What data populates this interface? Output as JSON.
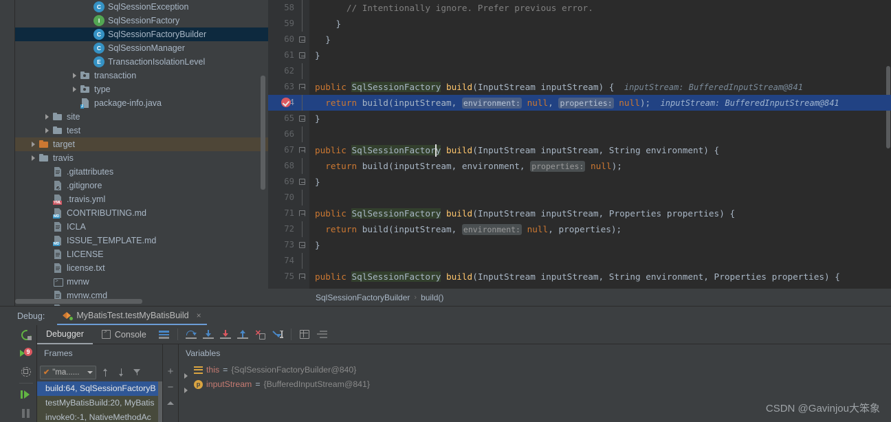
{
  "project_tree": {
    "items": [
      {
        "label": "SqlSessionException",
        "icon": "class-icon",
        "indent": 5,
        "type": "class",
        "twisty": false,
        "state": "normal"
      },
      {
        "label": "SqlSessionFactory",
        "icon": "interface-icon",
        "indent": 5,
        "type": "interface",
        "twisty": false,
        "state": "normal"
      },
      {
        "label": "SqlSessionFactoryBuilder",
        "icon": "class-icon",
        "indent": 5,
        "type": "class",
        "twisty": false,
        "state": "selected"
      },
      {
        "label": "SqlSessionManager",
        "icon": "class-icon",
        "indent": 5,
        "type": "class",
        "twisty": false,
        "state": "normal"
      },
      {
        "label": "TransactionIsolationLevel",
        "icon": "enum-icon",
        "indent": 5,
        "type": "enum",
        "twisty": false,
        "state": "normal"
      },
      {
        "label": "transaction",
        "icon": "package-folder-icon",
        "indent": 4,
        "type": "package",
        "twisty": true,
        "state": "normal"
      },
      {
        "label": "type",
        "icon": "package-folder-icon",
        "indent": 4,
        "type": "package",
        "twisty": true,
        "state": "normal"
      },
      {
        "label": "package-info.java",
        "icon": "java-file-icon",
        "indent": 4,
        "type": "javafile",
        "twisty": false,
        "state": "normal"
      },
      {
        "label": "site",
        "icon": "folder-icon",
        "indent": 2,
        "type": "folder",
        "twisty": true,
        "state": "normal"
      },
      {
        "label": "test",
        "icon": "folder-icon",
        "indent": 2,
        "type": "folder",
        "twisty": true,
        "state": "normal"
      },
      {
        "label": "target",
        "icon": "folder-icon-orange",
        "indent": 1,
        "type": "folder-orange",
        "twisty": true,
        "state": "target"
      },
      {
        "label": "travis",
        "icon": "folder-icon",
        "indent": 1,
        "type": "folder",
        "twisty": true,
        "state": "normal"
      },
      {
        "label": ".gitattributes",
        "icon": "text-file-icon",
        "indent": 2,
        "type": "file",
        "twisty": false,
        "state": "normal"
      },
      {
        "label": ".gitignore",
        "icon": "gitignore-file-icon",
        "indent": 2,
        "type": "gitignore",
        "twisty": false,
        "state": "normal"
      },
      {
        "label": ".travis.yml",
        "icon": "yaml-file-icon",
        "indent": 2,
        "type": "yml",
        "twisty": false,
        "state": "normal"
      },
      {
        "label": "CONTRIBUTING.md",
        "icon": "markdown-file-icon",
        "indent": 2,
        "type": "md",
        "twisty": false,
        "state": "normal"
      },
      {
        "label": "ICLA",
        "icon": "text-file-icon",
        "indent": 2,
        "type": "file",
        "twisty": false,
        "state": "normal"
      },
      {
        "label": "ISSUE_TEMPLATE.md",
        "icon": "markdown-file-icon",
        "indent": 2,
        "type": "md",
        "twisty": false,
        "state": "normal"
      },
      {
        "label": "LICENSE",
        "icon": "text-file-icon",
        "indent": 2,
        "type": "file",
        "twisty": false,
        "state": "normal"
      },
      {
        "label": "license.txt",
        "icon": "text-file-icon",
        "indent": 2,
        "type": "file",
        "twisty": false,
        "state": "normal"
      },
      {
        "label": "mvnw",
        "icon": "shell-file-icon",
        "indent": 2,
        "type": "sh",
        "twisty": false,
        "state": "normal"
      },
      {
        "label": "mvnw.cmd",
        "icon": "text-file-icon",
        "indent": 2,
        "type": "file",
        "twisty": false,
        "state": "normal"
      },
      {
        "label": "NOTICE",
        "icon": "text-file-icon",
        "indent": 2,
        "type": "file",
        "twisty": false,
        "state": "normal"
      }
    ]
  },
  "editor": {
    "lines": [
      {
        "num": "58",
        "fold": "none",
        "indent": 6,
        "segments": [
          {
            "t": "// Intentionally ignore. Prefer previous error.",
            "c": "cmt"
          }
        ]
      },
      {
        "num": "59",
        "fold": "none",
        "indent": 4,
        "segments": [
          {
            "t": "}",
            "c": "ident"
          }
        ]
      },
      {
        "num": "60",
        "fold": "end",
        "indent": 2,
        "segments": [
          {
            "t": "}",
            "c": "ident"
          }
        ]
      },
      {
        "num": "61",
        "fold": "end",
        "indent": 0,
        "segments": [
          {
            "t": "}",
            "c": "ident"
          }
        ]
      },
      {
        "num": "62",
        "fold": "none",
        "indent": 0,
        "segments": []
      },
      {
        "num": "63",
        "fold": "open",
        "indent": 0,
        "segments": [
          {
            "t": "public ",
            "c": "kw"
          },
          {
            "t": "SqlSessionFactory",
            "c": "type-hl"
          },
          {
            "t": " ",
            "c": "ident"
          },
          {
            "t": "build",
            "c": "mname"
          },
          {
            "t": "(InputStream inputStream) {",
            "c": "ident"
          },
          {
            "t": "  inputStream: BufferedInputStream@841",
            "c": "valhint"
          }
        ]
      },
      {
        "num": "64",
        "fold": "none",
        "indent": 2,
        "highlight": true,
        "breakpoint": true,
        "segments": [
          {
            "t": "return ",
            "c": "kw"
          },
          {
            "t": "build(inputStream, ",
            "c": "ident"
          },
          {
            "t": "environment:",
            "c": "hint"
          },
          {
            "t": " ",
            "c": "ident"
          },
          {
            "t": "null",
            "c": "kw"
          },
          {
            "t": ", ",
            "c": "ident"
          },
          {
            "t": "properties:",
            "c": "hint"
          },
          {
            "t": " ",
            "c": "ident"
          },
          {
            "t": "null",
            "c": "kw"
          },
          {
            "t": ");",
            "c": "ident"
          },
          {
            "t": "  inputStream: BufferedInputStream@841",
            "c": "valhint"
          }
        ]
      },
      {
        "num": "65",
        "fold": "end",
        "indent": 0,
        "segments": [
          {
            "t": "}",
            "c": "ident"
          }
        ]
      },
      {
        "num": "66",
        "fold": "none",
        "indent": 0,
        "segments": []
      },
      {
        "num": "67",
        "fold": "open",
        "indent": 0,
        "caret": true,
        "segments": [
          {
            "t": "public ",
            "c": "kw"
          },
          {
            "t": "SqlSessionFactory",
            "c": "type-hl"
          },
          {
            "t": " ",
            "c": "ident"
          },
          {
            "t": "build",
            "c": "mname"
          },
          {
            "t": "(InputStream inputStream, String environment) {",
            "c": "ident"
          }
        ]
      },
      {
        "num": "68",
        "fold": "none",
        "indent": 2,
        "segments": [
          {
            "t": "return ",
            "c": "kw"
          },
          {
            "t": "build(inputStream, environment, ",
            "c": "ident"
          },
          {
            "t": "properties:",
            "c": "hint"
          },
          {
            "t": " ",
            "c": "ident"
          },
          {
            "t": "null",
            "c": "kw"
          },
          {
            "t": ");",
            "c": "ident"
          }
        ]
      },
      {
        "num": "69",
        "fold": "end",
        "indent": 0,
        "segments": [
          {
            "t": "}",
            "c": "ident"
          }
        ]
      },
      {
        "num": "70",
        "fold": "none",
        "indent": 0,
        "segments": []
      },
      {
        "num": "71",
        "fold": "open",
        "indent": 0,
        "segments": [
          {
            "t": "public ",
            "c": "kw"
          },
          {
            "t": "SqlSessionFactory",
            "c": "type-hl"
          },
          {
            "t": " ",
            "c": "ident"
          },
          {
            "t": "build",
            "c": "mname"
          },
          {
            "t": "(InputStream inputStream, Properties properties) {",
            "c": "ident"
          }
        ]
      },
      {
        "num": "72",
        "fold": "none",
        "indent": 2,
        "segments": [
          {
            "t": "return ",
            "c": "kw"
          },
          {
            "t": "build(inputStream, ",
            "c": "ident"
          },
          {
            "t": "environment:",
            "c": "hint"
          },
          {
            "t": " ",
            "c": "ident"
          },
          {
            "t": "null",
            "c": "kw"
          },
          {
            "t": ", properties);",
            "c": "ident"
          }
        ]
      },
      {
        "num": "73",
        "fold": "end",
        "indent": 0,
        "segments": [
          {
            "t": "}",
            "c": "ident"
          }
        ]
      },
      {
        "num": "74",
        "fold": "none",
        "indent": 0,
        "segments": []
      },
      {
        "num": "75",
        "fold": "open",
        "indent": 0,
        "segments": [
          {
            "t": "public ",
            "c": "kw"
          },
          {
            "t": "SqlSessionFactory",
            "c": "type-hl"
          },
          {
            "t": " ",
            "c": "ident"
          },
          {
            "t": "build",
            "c": "mname"
          },
          {
            "t": "(InputStream inputStream, String environment, Properties properties) {",
            "c": "ident"
          }
        ]
      }
    ],
    "breadcrumb": {
      "class": "SqlSessionFactoryBuilder",
      "separator": "›",
      "method": "build()"
    }
  },
  "debug": {
    "label": "Debug:",
    "run_config": "MyBatisTest.testMyBatisBuild",
    "close_label": "×",
    "left_toolbar": [
      {
        "name": "rerun-button",
        "title": "Rerun"
      },
      {
        "name": "view-breakpoints-button",
        "title": "View Breakpoints",
        "badge": "9"
      },
      {
        "name": "restore-layout-button",
        "title": "Restore Layout"
      },
      {
        "name": "resume-program-button",
        "title": "Resume Program"
      },
      {
        "name": "pause-program-button",
        "title": "Pause Program"
      }
    ],
    "tabs": [
      {
        "label": "Debugger",
        "active": true
      },
      {
        "label": "Console",
        "active": false
      }
    ],
    "step_toolbar": [
      {
        "name": "mute-breakpoints-button",
        "title": "Mute Breakpoints"
      },
      {
        "name": "step-over-button",
        "title": "Step Over"
      },
      {
        "name": "step-into-button",
        "title": "Step Into"
      },
      {
        "name": "force-step-into-button",
        "title": "Force Step Into"
      },
      {
        "name": "step-out-button",
        "title": "Step Out"
      },
      {
        "name": "drop-frame-button",
        "title": "Drop Frame"
      },
      {
        "name": "run-to-cursor-button",
        "title": "Run to Cursor"
      },
      {
        "name": "evaluate-expression-button",
        "title": "Evaluate Expression"
      },
      {
        "name": "layout-settings-button",
        "title": "Layout Settings"
      }
    ],
    "frames": {
      "header": "Frames",
      "thread_selector": "\"ma......",
      "items": [
        {
          "label": "build:64, SqlSessionFactoryB",
          "state": "selected"
        },
        {
          "label": "testMyBatisBuild:20, MyBatis",
          "state": "dim"
        },
        {
          "label": "invoke0:-1, NativeMethodAc",
          "state": "dim2"
        }
      ]
    },
    "variables": {
      "header": "Variables",
      "items": [
        {
          "icon": "object-icon",
          "name": "this",
          "eq": "=",
          "value": "{SqlSessionFactoryBuilder@840}"
        },
        {
          "icon": "parameter-icon",
          "name": "inputStream",
          "eq": "=",
          "value": "{BufferedInputStream@841}"
        }
      ]
    }
  },
  "watermark": "CSDN @Gavinjou大笨象"
}
